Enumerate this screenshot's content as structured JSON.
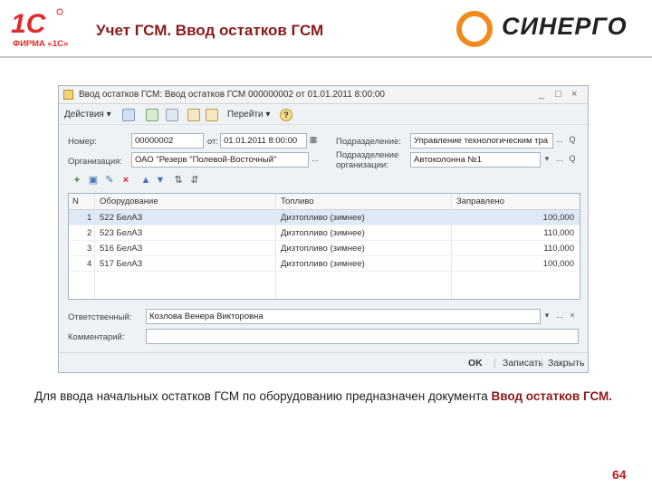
{
  "slide": {
    "title": "Учет ГСМ. Ввод остатков ГСМ",
    "logo_1c_caption": "ФИРМА «1С»",
    "logo_1c_mark": "1С",
    "logo_synergo": "СИНЕРГО",
    "caption_plain": "Для ввода начальных остатков ГСМ по оборудованию предназначен документа ",
    "caption_highlight": "Ввод остатков ГСМ.",
    "page_number": "64"
  },
  "window": {
    "title": "Ввод остатков ГСМ: Ввод остатков ГСМ 000000002 от 01.01.2011 8:00:00",
    "minimize": "_",
    "maximize": "□",
    "close": "×"
  },
  "toolbar": {
    "actions_label": "Действия",
    "goto_label": "Перейти",
    "help_label": "?"
  },
  "form": {
    "number_label": "Номер:",
    "number_value": "00000002",
    "date_label": "от:",
    "date_value": "01.01.2011  8:00:00",
    "department_label": "Подразделение:",
    "department_value": "Управление технологическим тра",
    "org_label": "Организация:",
    "org_value": "ОАО \"Резерв \"Полевой-Восточный\"",
    "org_department_label_1": "Подразделение",
    "org_department_label_2": "организации:",
    "org_department_value": "Автоколонна №1",
    "responsible_label": "Ответственный:",
    "responsible_value": "Козлова Венера Викторовна",
    "comment_label": "Комментарий:",
    "comment_value": ""
  },
  "table": {
    "columns": [
      "N",
      "Оборудование",
      "Топливо",
      "Заправлено"
    ],
    "rows": [
      {
        "n": "1",
        "equipment": "522 БелАЗ",
        "fuel": "Дизтопливо (зимнее)",
        "amount": "100,000"
      },
      {
        "n": "2",
        "equipment": "523 БелАЗ",
        "fuel": "Дизтопливо (зимнее)",
        "amount": "110,000"
      },
      {
        "n": "3",
        "equipment": "516 БелАЗ",
        "fuel": "Дизтопливо (зимнее)",
        "amount": "110,000"
      },
      {
        "n": "4",
        "equipment": "517 БелАЗ",
        "fuel": "Дизтопливо (зимнее)",
        "amount": "100,000"
      }
    ]
  },
  "buttons": {
    "ok": "OK",
    "save": "Записать",
    "close": "Закрыть"
  },
  "icons": {
    "select": "...",
    "clear": "×",
    "dropdown": "▾",
    "calendar": "▦",
    "search": "Q"
  },
  "colors": {
    "title_red": "#8b1a1a",
    "page_number": "#b52020",
    "selected_row": "#dfe9f5",
    "synergo_orange": "#f08a1c"
  }
}
